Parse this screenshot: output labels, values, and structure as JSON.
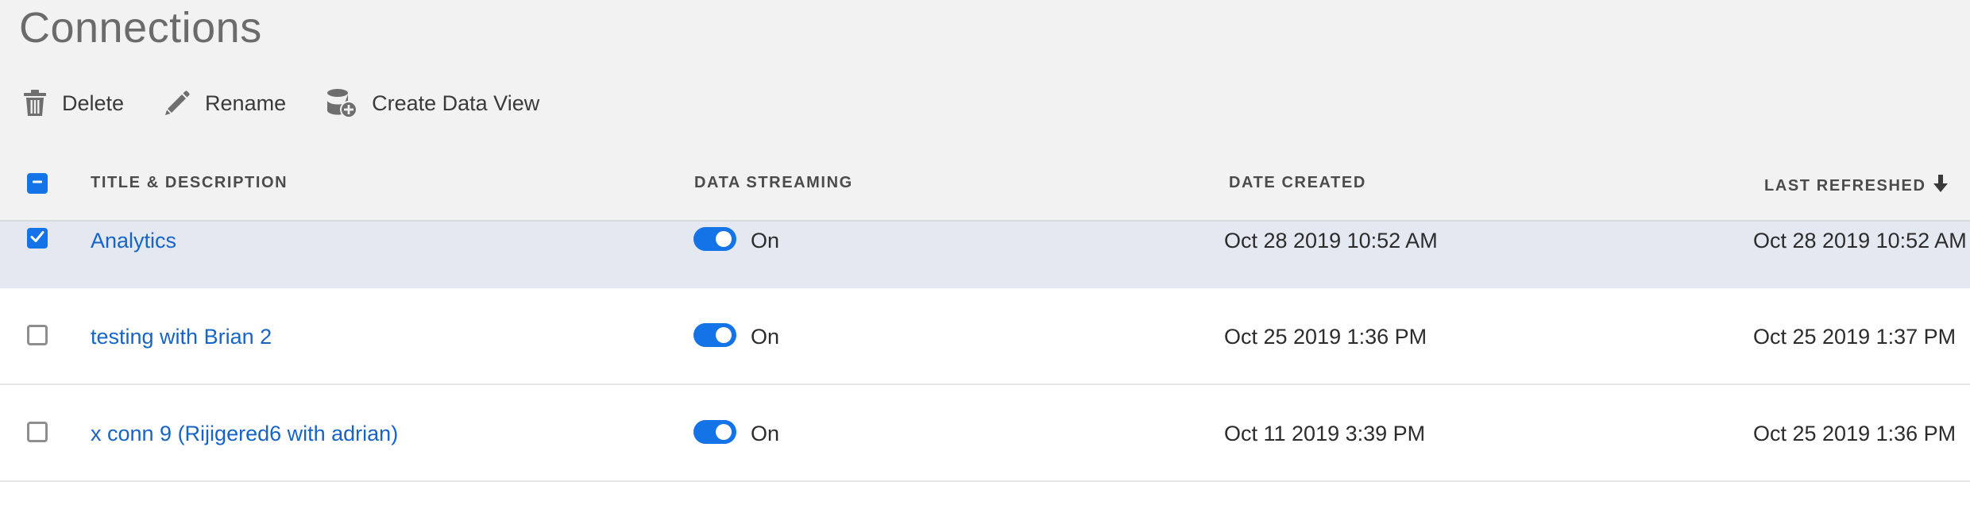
{
  "page": {
    "title": "Connections"
  },
  "toolbar": {
    "delete_label": "Delete",
    "rename_label": "Rename",
    "create_view_label": "Create Data View"
  },
  "table": {
    "headers": {
      "title": "TITLE & DESCRIPTION",
      "streaming": "DATA STREAMING",
      "created": "DATE CREATED",
      "refreshed": "LAST REFRESHED"
    },
    "sort": {
      "column": "LAST REFRESHED",
      "direction": "descending"
    },
    "header_checkbox_state": "indeterminate",
    "rows": [
      {
        "title": "Analytics",
        "streaming": "On",
        "created": "Oct 28 2019 10:52 AM",
        "refreshed": "Oct 28 2019 10:52 AM",
        "selected": true
      },
      {
        "title": "testing with Brian 2",
        "streaming": "On",
        "created": "Oct 25 2019 1:36 PM",
        "refreshed": "Oct 25 2019 1:37 PM",
        "selected": false
      },
      {
        "title": "x conn 9 (Rijigered6 with adrian)",
        "streaming": "On",
        "created": "Oct 11 2019 3:39 PM",
        "refreshed": "Oct 25 2019 1:36 PM",
        "selected": false
      }
    ]
  },
  "colors": {
    "accent": "#1473e6",
    "link": "#1564c6",
    "selected_row": "#e4e9f1",
    "toolbar_bg": "#f2f2f2"
  }
}
